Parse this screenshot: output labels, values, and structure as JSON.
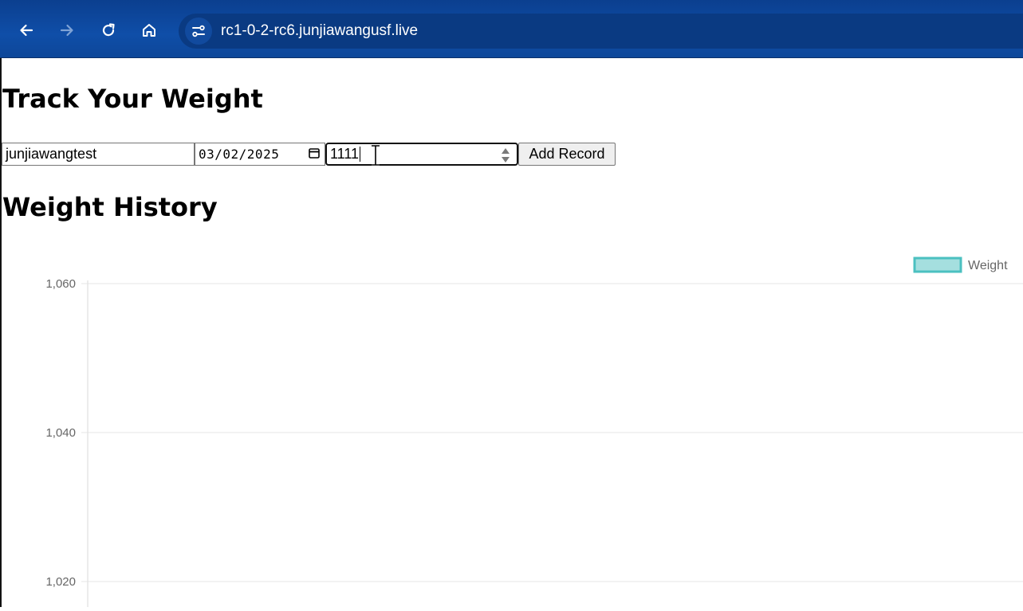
{
  "browser": {
    "url": "rc1-0-2-rc6.junjiawangusf.live",
    "icons": [
      "back-arrow-icon",
      "forward-arrow-icon",
      "reload-icon",
      "home-icon",
      "site-info-icon"
    ]
  },
  "page": {
    "title": "Track Your Weight",
    "form": {
      "username_value": "junjiawangtest",
      "date_value": "03/02/2025",
      "weight_value": "1111",
      "add_button_label": "Add Record"
    },
    "history_heading": "Weight History"
  },
  "chart_data": {
    "type": "line",
    "title": "",
    "xlabel": "",
    "ylabel": "",
    "legend": {
      "position": "top-right",
      "entries": [
        "Weight"
      ]
    },
    "series": [
      {
        "name": "Weight",
        "values": [],
        "color": "#4bc0c0",
        "fill": "rgba(75,192,192,0.4)"
      }
    ],
    "y_ticks": [
      "1,060",
      "1,040",
      "1,020"
    ],
    "y_tick_values": [
      1060,
      1040,
      1020
    ],
    "grid": true
  },
  "colors": {
    "browser_bar": "#0f4ea8",
    "legend_border": "#4bc0c0",
    "legend_fill": "#a5dfdf",
    "grid": "#e5e5e5",
    "axis_text": "#666666"
  }
}
